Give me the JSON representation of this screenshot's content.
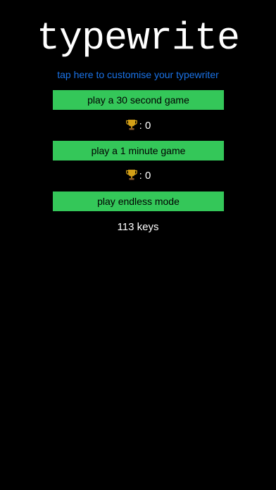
{
  "app": {
    "title": "typewrite"
  },
  "customise": {
    "label": "tap here to customise your typewriter"
  },
  "modes": [
    {
      "button_label": "play a 30 second game",
      "high_score": ": 0"
    },
    {
      "button_label": "play a 1 minute game",
      "high_score": ": 0"
    },
    {
      "button_label": "play endless mode"
    }
  ],
  "endless": {
    "keys_label": "113 keys"
  },
  "icons": {
    "trophy": "trophy-icon"
  },
  "colors": {
    "background": "#000000",
    "button": "#34c759",
    "link": "#1a73e8",
    "text": "#ffffff",
    "trophy": "#d4a017"
  }
}
